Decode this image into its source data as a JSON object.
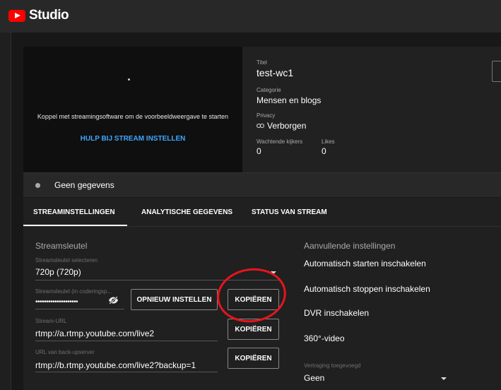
{
  "app": {
    "title": "Studio"
  },
  "preview": {
    "message": "Koppel met streamingsoftware om de voorbeeldweergave te starten",
    "help_link": "HULP BIJ STREAM INSTELLEN"
  },
  "info": {
    "title_label": "Titel",
    "title_value": "test-wc1",
    "category_label": "Categorie",
    "category_value": "Mensen en blogs",
    "privacy_label": "Privacy",
    "privacy_value": "Verborgen",
    "viewers_label": "Wachtende kijkers",
    "viewers_value": "0",
    "likes_label": "Likes",
    "likes_value": "0"
  },
  "status": {
    "text": "Geen gegevens"
  },
  "tabs": [
    {
      "label": "STREAMINSTELLINGEN",
      "active": true
    },
    {
      "label": "ANALYTISCHE GEGEVENS",
      "active": false
    },
    {
      "label": "STATUS VAN STREAM",
      "active": false
    }
  ],
  "stream_key": {
    "section_title": "Streamsleutel",
    "select_label": "Streamsleutel selecteren",
    "select_value": "720p (720p)",
    "key_label": "Streamsleutel (in coderingsp...",
    "key_value": "••••••••••••••••••••",
    "reset_button": "OPNIEUW INSTELLEN",
    "copy_button": "KOPIËREN",
    "url_label": "Stream-URL",
    "url_value": "rtmp://a.rtmp.youtube.com/live2",
    "url_copy_button": "KOPIËREN",
    "backup_label": "URL van back-upserver",
    "backup_value": "rtmp://b.rtmp.youtube.com/live2?backup=1",
    "backup_copy_button": "KOPIËREN"
  },
  "additional": {
    "section_title": "Aanvullende instellingen",
    "auto_start": "Automatisch starten inschakelen",
    "auto_stop": "Automatisch stoppen inschakelen",
    "dvr": "DVR inschakelen",
    "video360": "360°-video",
    "latency_label": "Vertraging toegevoegd",
    "latency_value": "Geen"
  },
  "colors": {
    "accent": "#3ea6ff",
    "brand": "#ff0000",
    "annotation": "#e8141c"
  }
}
